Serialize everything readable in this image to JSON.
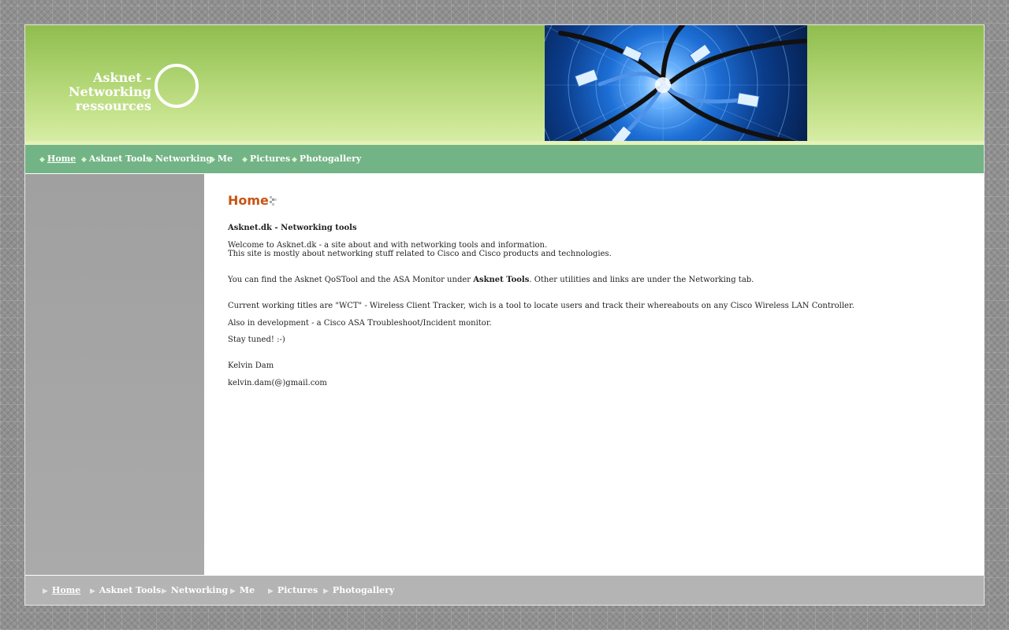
{
  "site": {
    "title_line1": "Asknet - Networking",
    "title_line2": "ressources"
  },
  "nav": {
    "items": [
      "Home",
      "Asknet Tools",
      "Networking",
      "Me",
      "Pictures",
      "Photogallery"
    ],
    "active": "Home"
  },
  "content": {
    "heading": "Home",
    "subtitle": "Asknet.dk - Networking tools",
    "welcome_line1": "Welcome to Asknet.dk - a site about and with networking tools and information.",
    "welcome_line2": "This site is mostly about networking stuff related to Cisco and Cisco products and technologies.",
    "tools_pre": "You can find the Asknet QoSTool and the ASA Monitor under ",
    "tools_bold": "Asknet Tools",
    "tools_post": ". Other utilities and links are under the Networking tab.",
    "current": "Current working titles are \"WCT\" - Wireless Client Tracker, wich is a tool to locate users and track their whereabouts on any Cisco Wireless LAN Controller.",
    "also": "Also in development -  a Cisco ASA Troubleshoot/Incident monitor.",
    "stay": "Stay tuned! :-)",
    "author": "Kelvin Dam",
    "email": "kelvin.dam(@)gmail.com"
  },
  "footer_nav": {
    "items": [
      "Home",
      "Asknet Tools",
      "Networking",
      "Me",
      "Pictures",
      "Photogallery"
    ],
    "active": "Home"
  },
  "colors": {
    "header_green": "#a8cf6a",
    "nav_green": "#72b485",
    "heading_orange": "#c85414",
    "sidebar_gray": "#a5a5a5"
  },
  "icons": {
    "logo": "ring-logo-icon",
    "nav_bullet": "diamond-bullet-icon",
    "footer_bullet": "triangle-right-icon",
    "heading_marker": "pixel-dots-icon"
  }
}
